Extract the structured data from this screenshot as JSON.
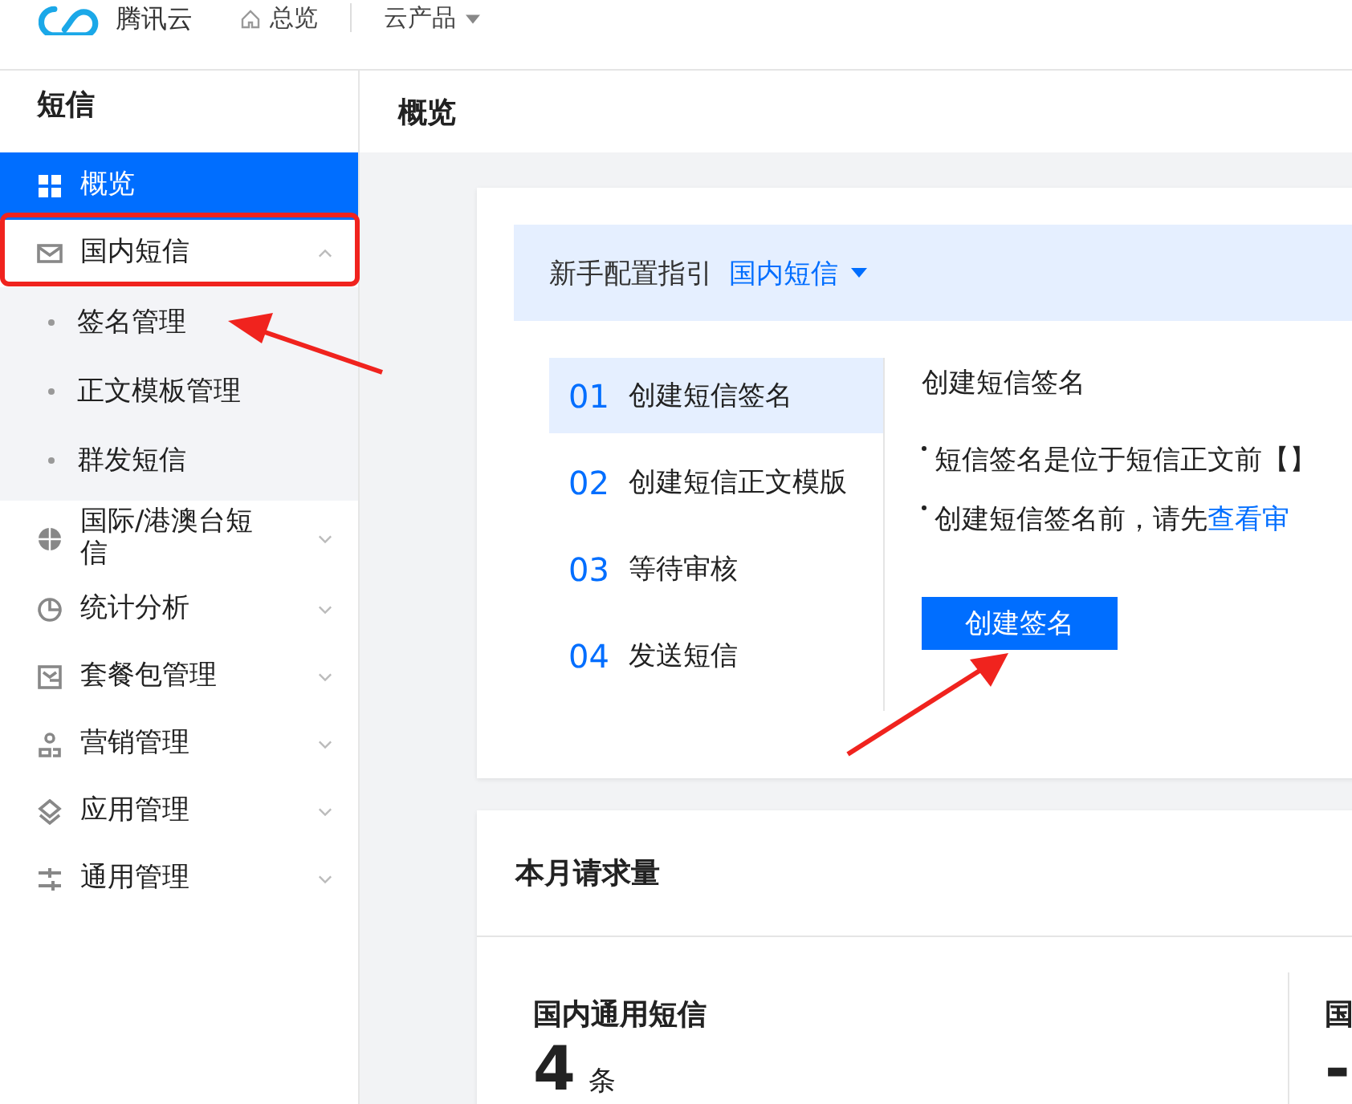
{
  "header": {
    "brand": "腾讯云",
    "nav": [
      {
        "label": "总览",
        "kind": "home"
      },
      {
        "label": "云产品",
        "kind": "dropdown"
      }
    ]
  },
  "sidebar": {
    "title": "短信",
    "items": [
      {
        "label": "概览",
        "kind": "grid",
        "selected": true
      },
      {
        "label": "国内短信",
        "kind": "mail",
        "selected": false,
        "expanded": true,
        "children": [
          {
            "label": "签名管理"
          },
          {
            "label": "正文模板管理"
          },
          {
            "label": "群发短信"
          }
        ]
      },
      {
        "label": "国际/港澳台短信",
        "kind": "globe",
        "selected": false,
        "expanded": false
      },
      {
        "label": "统计分析",
        "kind": "pie",
        "selected": false,
        "expanded": false
      },
      {
        "label": "套餐包管理",
        "kind": "package",
        "selected": false,
        "expanded": false
      },
      {
        "label": "营销管理",
        "kind": "people",
        "selected": false,
        "expanded": false
      },
      {
        "label": "应用管理",
        "kind": "layers",
        "selected": false,
        "expanded": false
      },
      {
        "label": "通用管理",
        "kind": "sliders",
        "selected": false,
        "expanded": false
      }
    ]
  },
  "page": {
    "title": "概览"
  },
  "guide": {
    "label": "新手配置指引",
    "product": "国内短信",
    "steps": [
      {
        "number": "01",
        "label": "创建短信签名",
        "selected": true
      },
      {
        "number": "02",
        "label": "创建短信正文模版",
        "selected": false
      },
      {
        "number": "03",
        "label": "等待审核",
        "selected": false
      },
      {
        "number": "04",
        "label": "发送短信",
        "selected": false
      }
    ],
    "detail": {
      "title": "创建短信签名",
      "bullets": [
        {
          "text": "短信签名是位于短信正文前【】"
        },
        {
          "text": "创建短信签名前，请先",
          "link": "查看审"
        }
      ],
      "button": "创建签名"
    }
  },
  "stats": {
    "title": "本月请求量",
    "items": [
      {
        "title": "国内通用短信",
        "value": "4",
        "unit": "条"
      },
      {
        "title": "国",
        "value": "-"
      }
    ]
  }
}
